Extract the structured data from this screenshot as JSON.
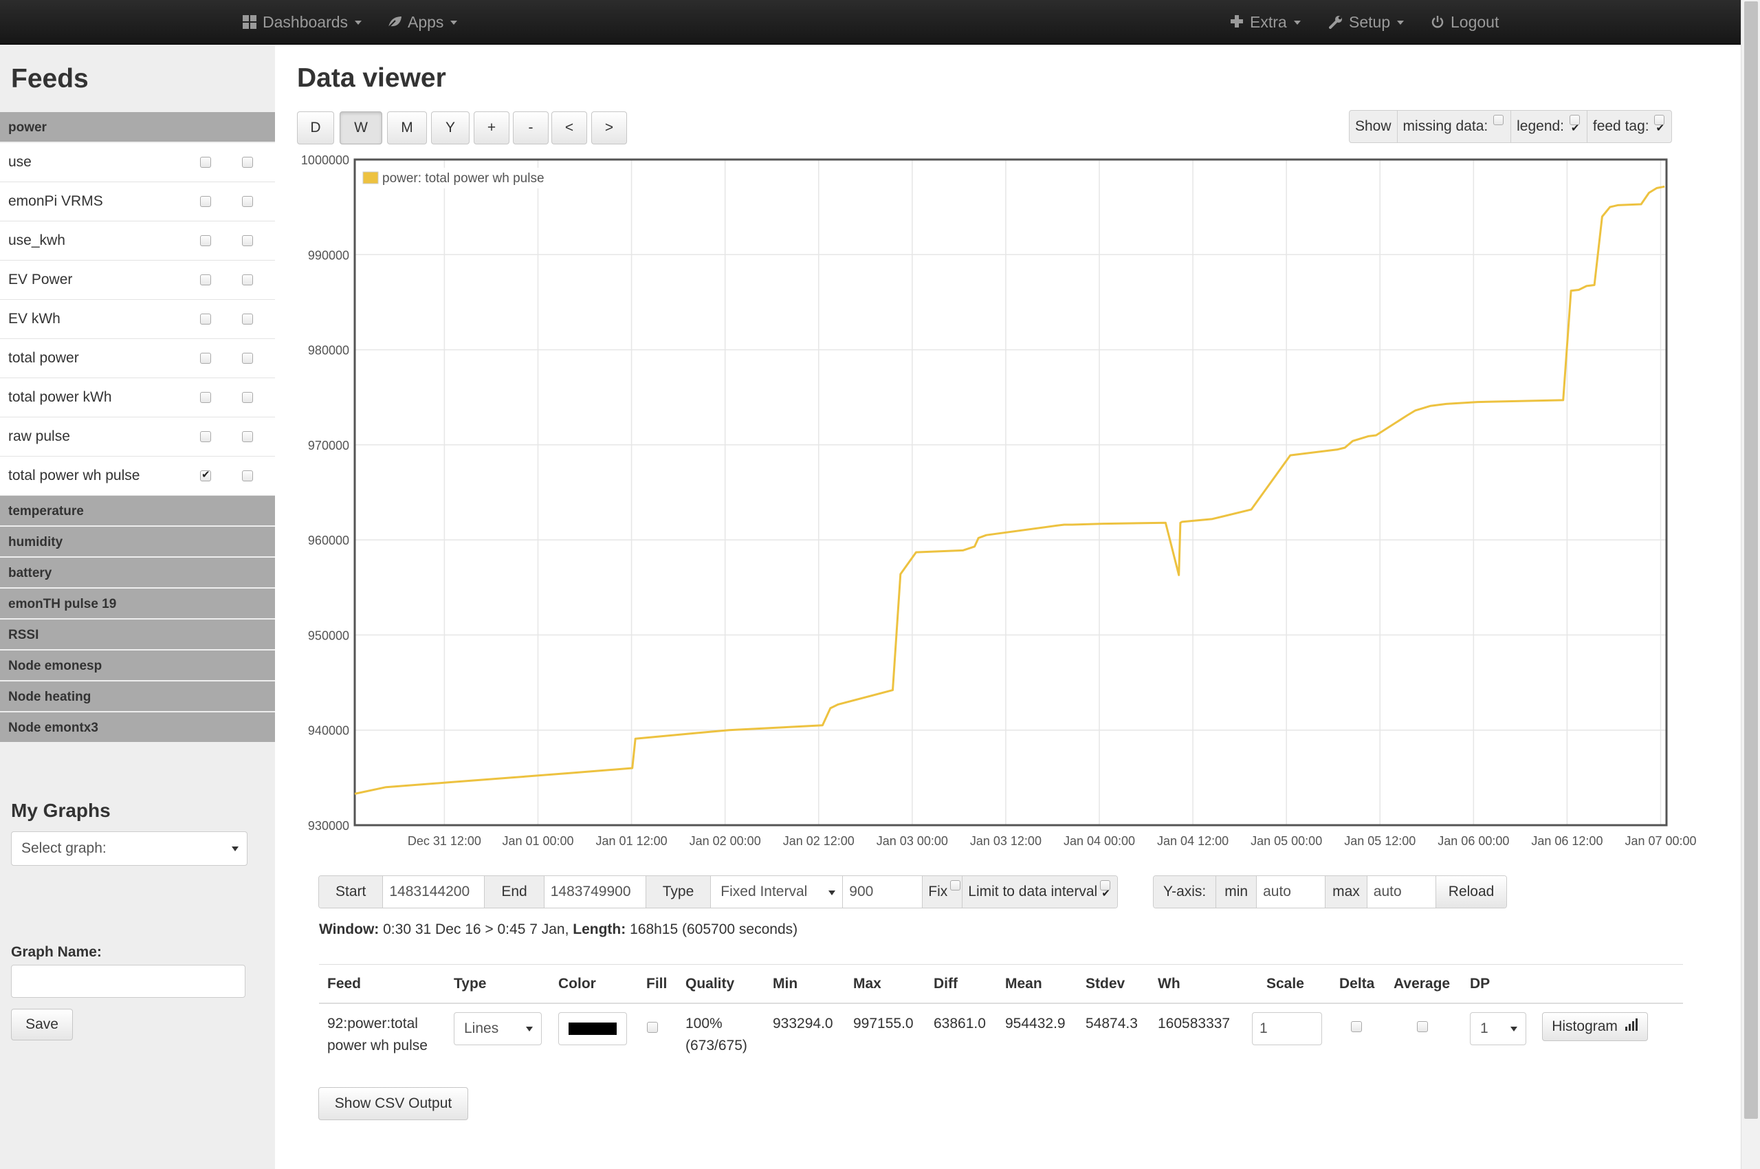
{
  "navbar": {
    "dashboards": "Dashboards",
    "apps": "Apps",
    "extra": "Extra",
    "setup": "Setup",
    "logout": "Logout"
  },
  "sidebar": {
    "title": "Feeds",
    "groups": [
      {
        "name": "power",
        "feeds": [
          {
            "name": "use",
            "left_checked": false,
            "right_checked": false
          },
          {
            "name": "emonPi VRMS",
            "left_checked": false,
            "right_checked": false
          },
          {
            "name": "use_kwh",
            "left_checked": false,
            "right_checked": false
          },
          {
            "name": "EV Power",
            "left_checked": false,
            "right_checked": false
          },
          {
            "name": "EV kWh",
            "left_checked": false,
            "right_checked": false
          },
          {
            "name": "total power",
            "left_checked": false,
            "right_checked": false
          },
          {
            "name": "total power kWh",
            "left_checked": false,
            "right_checked": false
          },
          {
            "name": "raw pulse",
            "left_checked": false,
            "right_checked": false
          },
          {
            "name": "total power wh pulse",
            "left_checked": true,
            "right_checked": false
          }
        ]
      },
      {
        "name": "temperature"
      },
      {
        "name": "humidity"
      },
      {
        "name": "battery"
      },
      {
        "name": "emonTH pulse 19"
      },
      {
        "name": "RSSI"
      },
      {
        "name": "Node emonesp"
      },
      {
        "name": "Node heating"
      },
      {
        "name": "Node emontx3"
      }
    ],
    "my_graphs_title": "My Graphs",
    "select_graph": "Select graph:",
    "graph_name_label": "Graph Name:",
    "graph_name_value": "",
    "save_label": "Save"
  },
  "main": {
    "title": "Data viewer",
    "range_buttons": [
      "D",
      "W",
      "M",
      "Y",
      "+",
      "-",
      "<",
      ">"
    ],
    "active_range": "W",
    "show": {
      "show_label": "Show",
      "missing_data_label": "missing data:",
      "missing_data_checked": false,
      "legend_label": "legend:",
      "legend_checked": true,
      "feed_tag_label": "feed tag:",
      "feed_tag_checked": true
    }
  },
  "chart_data": {
    "type": "line",
    "legend": [
      "power: total power wh pulse"
    ],
    "series_color": "#edc240",
    "ylim": [
      930000,
      1000000
    ],
    "y_ticks": [
      "930000",
      "940000",
      "950000",
      "960000",
      "970000",
      "980000",
      "990000",
      "1000000"
    ],
    "x_ticks": [
      "Dec 31 12:00",
      "Jan 01 00:00",
      "Jan 01 12:00",
      "Jan 02 00:00",
      "Jan 02 12:00",
      "Jan 03 00:00",
      "Jan 03 12:00",
      "Jan 04 00:00",
      "Jan 04 12:00",
      "Jan 05 00:00",
      "Jan 05 12:00",
      "Jan 06 00:00",
      "Jan 06 12:00",
      "Jan 07 00:00"
    ],
    "x_hours_from_dec31_0030": [
      0,
      4,
      12,
      20,
      28,
      35.6,
      36,
      48,
      60,
      61,
      62,
      69,
      70,
      72,
      78,
      79.5,
      80,
      81,
      90,
      91,
      92,
      96,
      104,
      105.7,
      105.9,
      106.1,
      110,
      114,
      115,
      120,
      126,
      127,
      128,
      130,
      131,
      135,
      136,
      138,
      140,
      144,
      155,
      156,
      157,
      158,
      159,
      160,
      161,
      162,
      165,
      166,
      167,
      168
    ],
    "y_values": [
      933294,
      934000,
      934500,
      935000,
      935500,
      936000,
      939100,
      940000,
      940500,
      942300,
      942700,
      944200,
      956400,
      958700,
      958900,
      959300,
      960200,
      960500,
      961500,
      961600,
      961600,
      961700,
      961800,
      956300,
      961800,
      961900,
      962200,
      963000,
      963200,
      968900,
      969500,
      969700,
      970400,
      970900,
      971000,
      973100,
      973600,
      974100,
      974300,
      974500,
      974700,
      986200,
      986300,
      986700,
      986800,
      994000,
      995000,
      995200,
      995300,
      996500,
      997000,
      997155
    ],
    "grid": true,
    "legend_position": "top-left"
  },
  "controls": {
    "start_label": "Start",
    "start_value": "1483144200",
    "end_label": "End",
    "end_value": "1483749900",
    "type_label": "Type",
    "type_value": "Fixed Interval",
    "interval_value": "900",
    "fix_label": "Fix",
    "fix_checked": false,
    "limit_label": "Limit to data interval",
    "limit_checked": true,
    "yaxis_label": "Y-axis:",
    "min_label": "min",
    "min_value": "auto",
    "max_label": "max",
    "max_value": "auto",
    "reload_label": "Reload"
  },
  "window_info": {
    "window_label": "Window:",
    "window_value": "0:30 31 Dec 16 > 0:45 7 Jan,",
    "length_label": "Length:",
    "length_value": "168h15 (605700 seconds)"
  },
  "table": {
    "headers": [
      "Feed",
      "Type",
      "Color",
      "Fill",
      "Quality",
      "Min",
      "Max",
      "Diff",
      "Mean",
      "Stdev",
      "Wh",
      "Scale",
      "Delta",
      "Average",
      "DP"
    ],
    "row": {
      "feed_line1": "92:power:total",
      "feed_line2": "power wh pulse",
      "type": "Lines",
      "color": "#000000",
      "fill_checked": false,
      "quality_line1": "100%",
      "quality_line2": "(673/675)",
      "min": "933294.0",
      "max": "997155.0",
      "diff": "63861.0",
      "mean": "954432.9",
      "stdev": "54874.3",
      "wh": "160583337",
      "scale": "1",
      "delta_checked": false,
      "average_checked": false,
      "dp": "1",
      "histogram_label": "Histogram"
    }
  },
  "csv_button": "Show CSV Output"
}
